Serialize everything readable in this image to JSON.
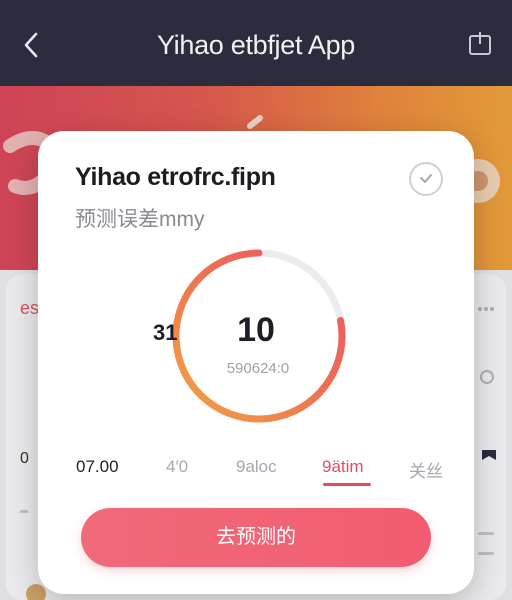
{
  "appbar": {
    "title": "Yihao etbfjet App",
    "back_icon": "chevron-left-icon",
    "share_icon": "share-icon"
  },
  "theme": {
    "bar_color": "#2b2d3e",
    "accent": "#e64a5f",
    "gradient_start": "#d9465a",
    "gradient_end": "#efa23a",
    "ring_track": "#ececee",
    "ring_orange": "#f2a441",
    "ring_red": "#ec5565"
  },
  "background": {
    "left_fragment": "es",
    "row_fragment": "0"
  },
  "modal": {
    "title": "Yihao etrofrc.fipn",
    "subtitle": "预测误差mmy",
    "check_icon": "check-circle-icon",
    "ring": {
      "value": "10",
      "sub_value": "590624:0",
      "side_value": "31",
      "progress_fraction": 0.78
    },
    "tabs": [
      {
        "label": "07.00"
      },
      {
        "label": "4′0"
      },
      {
        "label": "9aloc"
      },
      {
        "label": "9ätim"
      },
      {
        "label": "关丝"
      }
    ],
    "active_tab_index": 3,
    "cta_label": "去预测的"
  }
}
